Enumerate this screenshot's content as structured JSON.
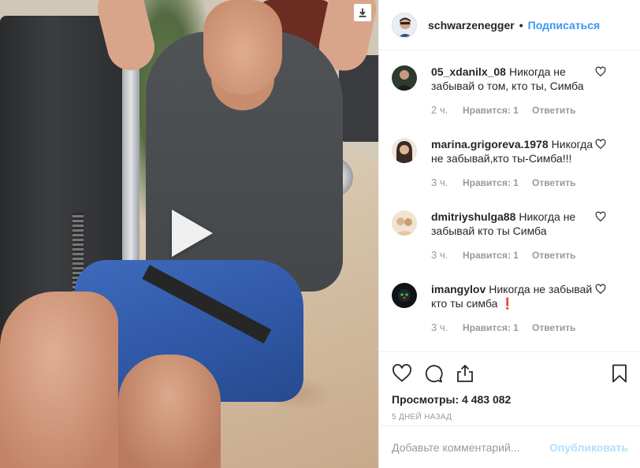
{
  "media": {
    "play_icon": "play-icon",
    "download_icon": "download-icon"
  },
  "header": {
    "username": "schwarzenegger",
    "separator": "•",
    "follow_label": "Подписаться"
  },
  "comments": [
    {
      "user": "05_xdanilx_08",
      "text": "Никогда не забывай о том, кто ты, Симба",
      "time": "2 ч.",
      "likes": "Нравится: 1",
      "reply": "Ответить",
      "avatar_color": "#2d3a2c"
    },
    {
      "user": "marina.grigoreva.1978",
      "text": "Никогда не забывай,кто ты-Симба!!!",
      "time": "3 ч.",
      "likes": "Нравится: 1",
      "reply": "Ответить",
      "avatar_color": "#3b2a24"
    },
    {
      "user": "dmitriyshulga88",
      "text": "Никогда не забывай кто ты Симба",
      "time": "3 ч.",
      "likes": "Нравится: 1",
      "reply": "Ответить",
      "avatar_color": "#d9b48a"
    },
    {
      "user": "imangylov",
      "text": "Никогда не забывай кто ты симба ❗",
      "time": "3 ч.",
      "likes": "Нравится: 1",
      "reply": "Ответить",
      "avatar_color": "#101418"
    }
  ],
  "actions": {
    "views": "Просмотры: 4 483 082",
    "date": "5 дней назад"
  },
  "add_comment": {
    "placeholder": "Добавьте комментарий...",
    "publish_label": "Опубликовать"
  },
  "colors": {
    "link_blue": "#3897f0",
    "publish_disabled": "#b2dffc",
    "muted": "#999999"
  }
}
